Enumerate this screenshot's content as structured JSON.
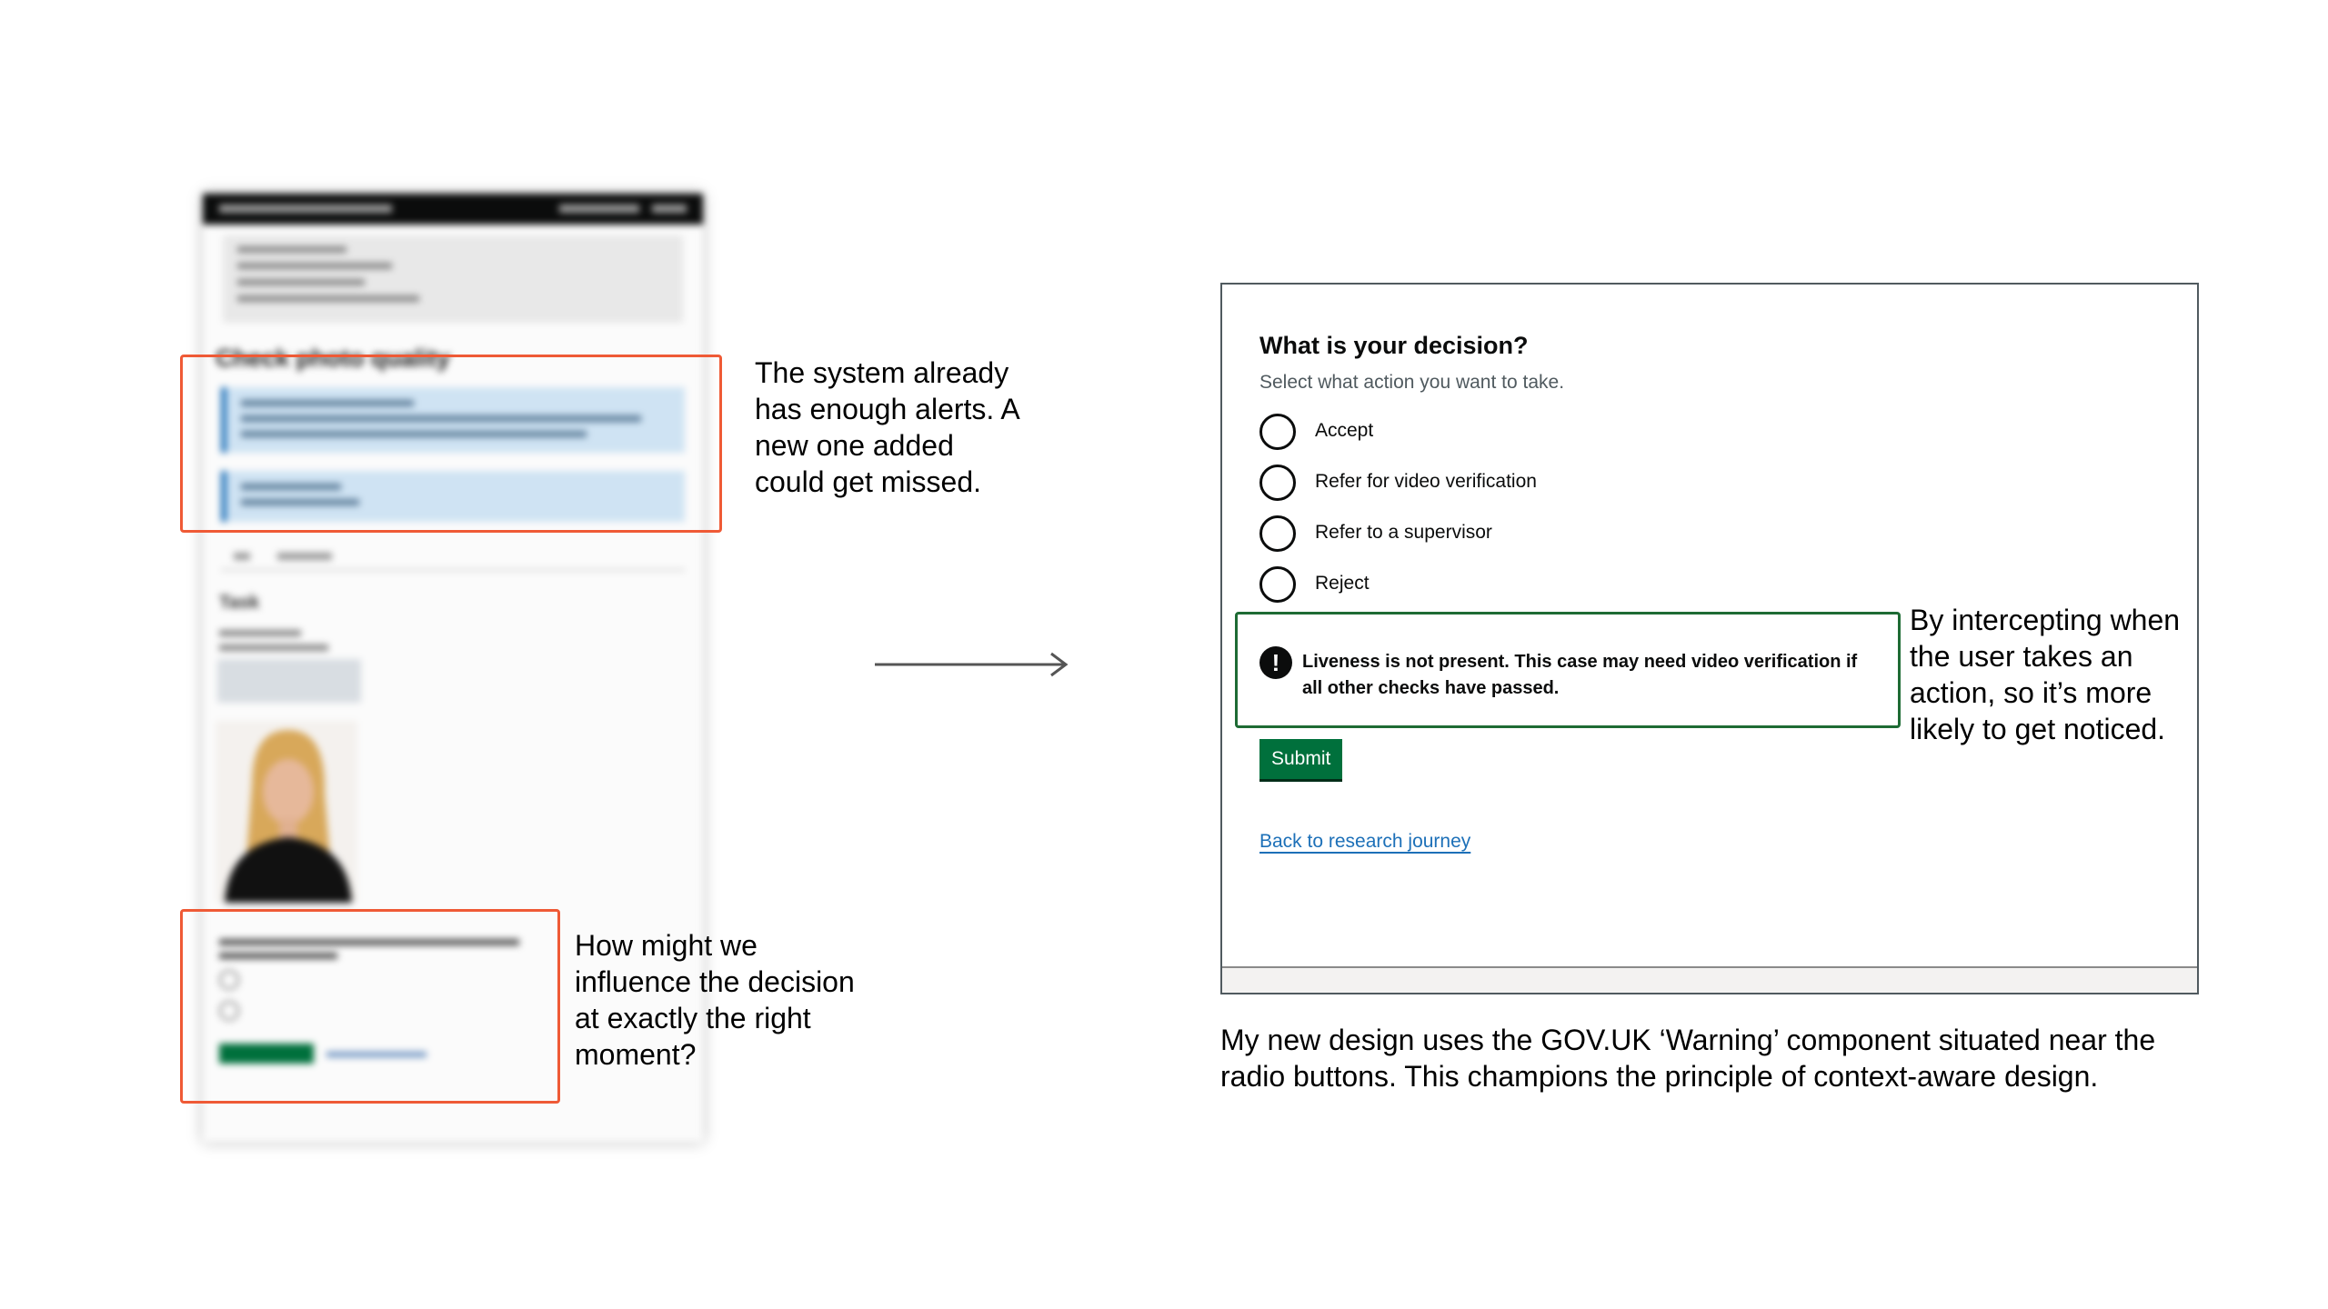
{
  "annotations": {
    "alerts_note": "The system already has enough alerts. A new one added could get missed.",
    "decision_note": "How might we influence the decision at exactly the right moment?",
    "intercept_note": "By intercepting when the user takes an action, so it’s more likely to get noticed.",
    "caption": "My new design uses the GOV.UK ‘Warning’ component situated near the radio buttons. This champions the principle of context-aware design."
  },
  "old_screen": {
    "heading": "Check photo quality",
    "task_label": "Task"
  },
  "new_design": {
    "heading": "What is your decision?",
    "hint": "Select what action you want to take.",
    "options": [
      {
        "label": "Accept"
      },
      {
        "label": "Refer for video verification"
      },
      {
        "label": "Refer to a supervisor"
      },
      {
        "label": "Reject"
      }
    ],
    "warning": {
      "icon": "!",
      "text": "Liveness is not present. This case may need video verification if all other checks have passed."
    },
    "submit_label": "Submit",
    "back_link": "Back to research journey"
  },
  "colors": {
    "annotation_border": "#ef5a36",
    "warning_border": "#1e6b34",
    "button_green": "#00703c",
    "link_blue": "#1d70b8"
  }
}
